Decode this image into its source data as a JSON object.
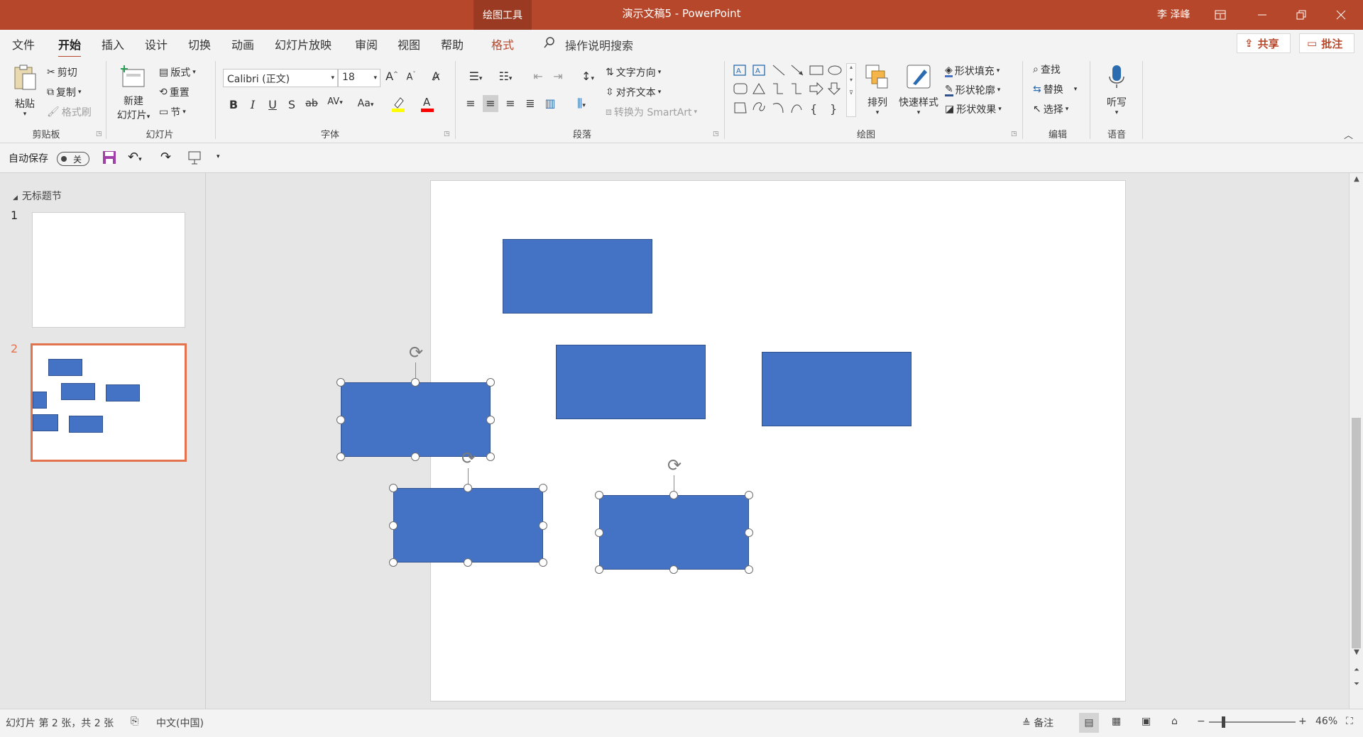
{
  "titlebar": {
    "context_tab": "绘图工具",
    "title": "演示文稿5  -  PowerPoint",
    "user": "李 泽峰",
    "ribbon_display_icon": "ribbon-display-options-icon",
    "minimize_icon": "minimize-icon",
    "restore_icon": "restore-icon",
    "close_icon": "close-icon"
  },
  "tabs": {
    "items": [
      "文件",
      "开始",
      "插入",
      "设计",
      "切换",
      "动画",
      "幻灯片放映",
      "审阅",
      "视图",
      "帮助",
      "格式"
    ],
    "active": "开始",
    "search_label": "操作说明搜索",
    "share_label": "共享",
    "comments_label": "批注"
  },
  "ribbon": {
    "clipboard": {
      "label": "剪贴板",
      "paste": "粘贴",
      "cut": "剪切",
      "copy": "复制",
      "format_painter": "格式刷"
    },
    "slides": {
      "label": "幻灯片",
      "new_slide_1": "新建",
      "new_slide_2": "幻灯片",
      "layout": "版式",
      "reset": "重置",
      "section": "节"
    },
    "font": {
      "label": "字体",
      "font_name": "Calibri (正文)",
      "font_size": "18",
      "bold": "B",
      "italic": "I",
      "underline": "U",
      "shadow": "S",
      "strike": "ab",
      "spacing": "AV",
      "case": "Aa",
      "color_highlight": "#ffff00",
      "color_font": "#ff0000"
    },
    "paragraph": {
      "label": "段落",
      "text_direction": "文字方向",
      "align_text": "对齐文本",
      "smartart": "转换为 SmartArt"
    },
    "drawing": {
      "label": "绘图",
      "arrange": "排列",
      "quick_styles": "快速样式",
      "shape_fill": "形状填充",
      "shape_outline": "形状轮廓",
      "shape_effects": "形状效果"
    },
    "editing": {
      "label": "编辑",
      "find": "查找",
      "replace": "替换",
      "select": "选择"
    },
    "voice": {
      "label": "语音",
      "dictate": "听写"
    }
  },
  "qat": {
    "autosave_label": "自动保存",
    "autosave_state": "关"
  },
  "thumbnails": {
    "section": "无标题节",
    "slides": [
      {
        "number": "1"
      },
      {
        "number": "2"
      }
    ],
    "selected": "2"
  },
  "status": {
    "slide_info": "幻灯片 第 2 张，共 2 张",
    "language": "中文(中国)",
    "notes": "备注",
    "zoom": "46%"
  },
  "colors": {
    "accent": "#b7472a",
    "shape_fill": "#4472c4",
    "shape_border": "#2f528f",
    "thumb_selected": "#e2734d"
  }
}
